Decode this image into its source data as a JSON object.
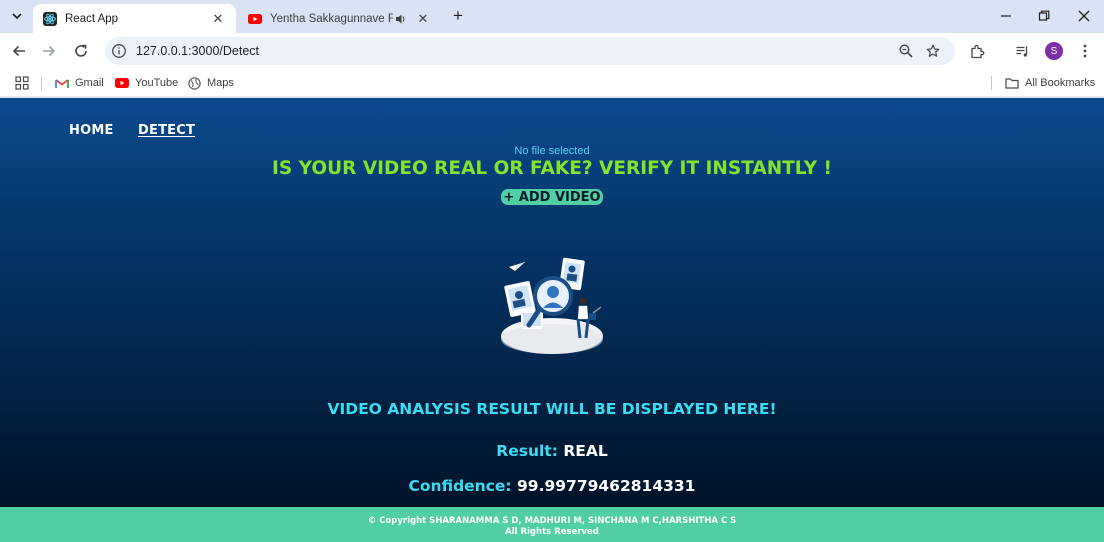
{
  "browser": {
    "tabs": [
      {
        "title": "React App",
        "active": true,
        "icon": "react-icon"
      },
      {
        "title": "Yentha Sakkagunnave Full V",
        "active": false,
        "icon": "youtube-icon",
        "audio": true
      }
    ],
    "address": "127.0.0.1:3000/Detect",
    "profile_initial": "S",
    "bookmarks": [
      {
        "label": "Gmail",
        "icon": "gmail-icon"
      },
      {
        "label": "YouTube",
        "icon": "youtube-icon"
      },
      {
        "label": "Maps",
        "icon": "maps-icon"
      }
    ],
    "all_bookmarks": "All Bookmarks"
  },
  "app": {
    "nav": {
      "home": "HOME",
      "detect": "DETECT"
    },
    "file_status": "No file selected",
    "headline": "IS YOUR VIDEO REAL OR FAKE? VERIFY IT INSTANTLY !",
    "add_button": "+ ADD VIDEO",
    "result_heading": "VIDEO ANALYSIS RESULT WILL BE DISPLAYED HERE!",
    "result_label": "Result:",
    "result_value": "REAL",
    "confidence_label": "Confidence:",
    "confidence_value": "99.99779462814331",
    "footer_line1": "© Copyright SHARANAMMA S D, MADHURI M, SINCHANA M C,HARSHITHA C S",
    "footer_line2": "All Rights Reserved"
  },
  "colors": {
    "headline": "#85e32b",
    "accent": "#39dcf2",
    "button": "#4fcfa3",
    "footer": "#4fcfa3"
  }
}
